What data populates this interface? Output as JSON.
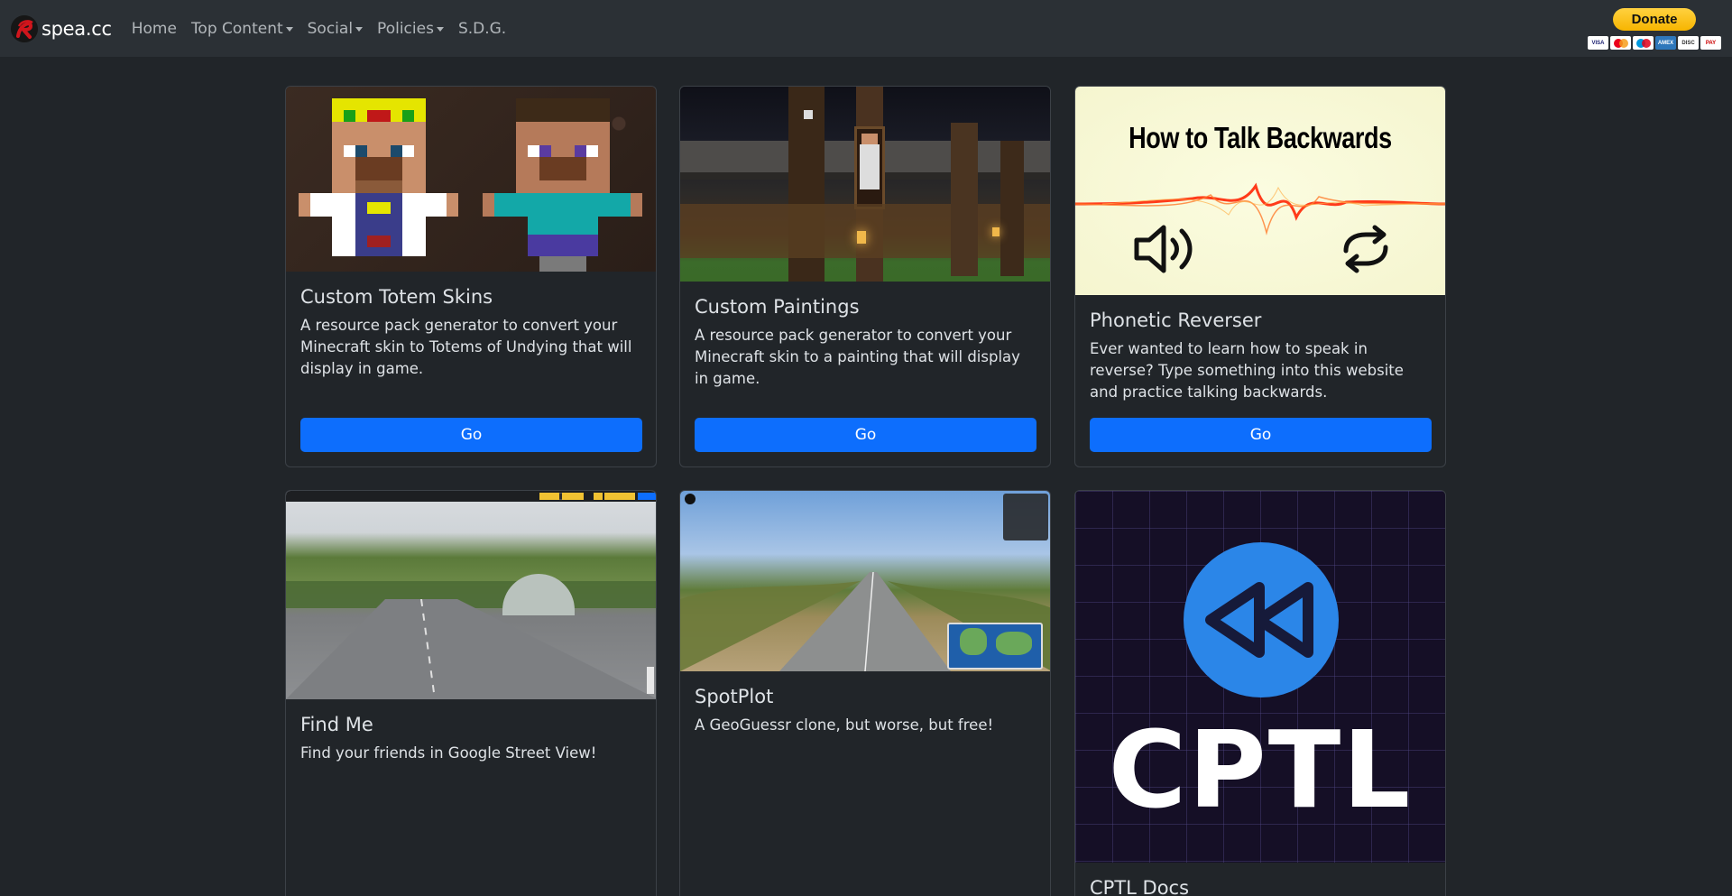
{
  "navbar": {
    "brand": "spea.cc",
    "items": [
      {
        "label": "Home",
        "dropdown": false
      },
      {
        "label": "Top Content",
        "dropdown": true
      },
      {
        "label": "Social",
        "dropdown": true
      },
      {
        "label": "Policies",
        "dropdown": true
      },
      {
        "label": "S.D.G.",
        "dropdown": false
      }
    ],
    "donate_label": "Donate",
    "payment_icons": [
      "VISA",
      "MC",
      "MAE",
      "AMEX",
      "DISC",
      "PAY"
    ]
  },
  "cards": [
    {
      "title": "Custom Totem Skins",
      "text": "A resource pack generator to convert your Minecraft skin to Totems of Undying that will display in game.",
      "button": "Go"
    },
    {
      "title": "Custom Paintings",
      "text": "A resource pack generator to convert your Minecraft skin to a painting that will display in game.",
      "button": "Go"
    },
    {
      "title": "Phonetic Reverser",
      "text": "Ever wanted to learn how to speak in reverse? Type something into this website and practice talking backwards.",
      "button": "Go",
      "image_title": "How to Talk Backwards"
    },
    {
      "title": "Find Me",
      "text": "Find your friends in Google Street View!"
    },
    {
      "title": "SpotPlot",
      "text": "A GeoGuessr clone, but worse, but free!"
    },
    {
      "title": "CPTL Docs",
      "image_title": "CPTL"
    }
  ],
  "colors": {
    "background": "#212529",
    "navbar": "#2b3035",
    "primary": "#0d6efd",
    "donate": "#ffc439"
  }
}
